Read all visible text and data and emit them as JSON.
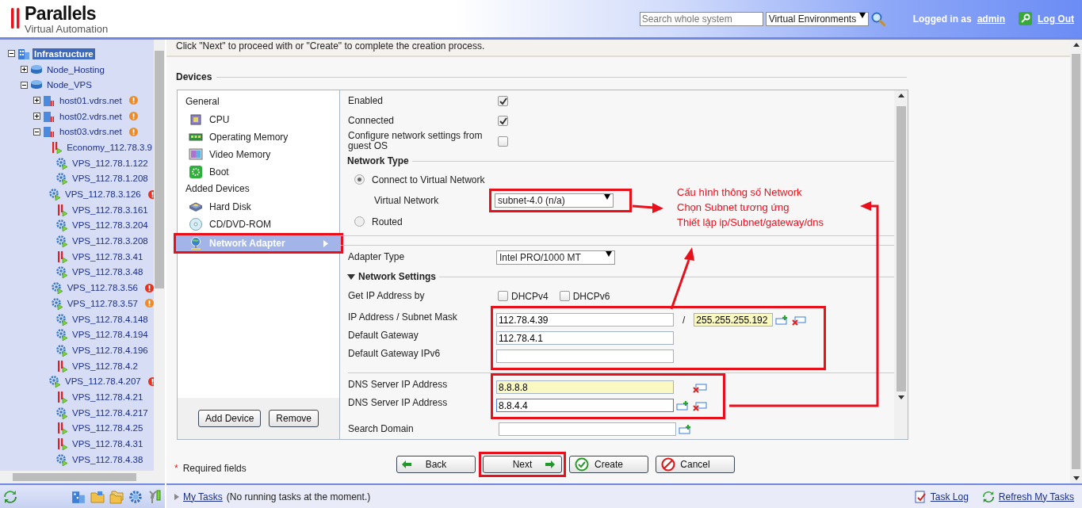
{
  "header": {
    "brand": "Parallels",
    "product": "Virtual Automation",
    "search": {
      "placeholder": "Search whole system"
    },
    "scope": {
      "value": "Virtual Environments"
    },
    "logged_in_label": "Logged in as",
    "user": "admin",
    "logout": "Log Out"
  },
  "tree": [
    {
      "label": "Infrastructure",
      "kind": "datacenter",
      "selected": true,
      "expanded": true,
      "children": [
        {
          "label": "Node_Hosting",
          "kind": "group",
          "selected": false,
          "expanded": false
        },
        {
          "label": "Node_VPS",
          "kind": "group",
          "selected": false,
          "expanded": true,
          "children": [
            {
              "label": "host01.vdrs.net",
              "kind": "host",
              "selected": false,
              "expanded": false,
              "color": "#f08a24"
            },
            {
              "label": "host02.vdrs.net",
              "kind": "host",
              "selected": false,
              "expanded": false,
              "color": "#f08a24"
            },
            {
              "label": "host03.vdrs.net",
              "kind": "host",
              "selected": false,
              "expanded": true,
              "color": "#f08a24",
              "children": [
                {
                  "label": "Economy_112.78.3.9",
                  "kind": "vm",
                  "selected": false
                },
                {
                  "label": "VPS_112.78.1.122",
                  "kind": "container",
                  "selected": false
                },
                {
                  "label": "VPS_112.78.1.208",
                  "kind": "container",
                  "selected": false
                },
                {
                  "label": "VPS_112.78.3.126",
                  "kind": "container",
                  "selected": false,
                  "color": "#e8301e"
                },
                {
                  "label": "VPS_112.78.3.161",
                  "kind": "vm",
                  "selected": false
                },
                {
                  "label": "VPS_112.78.3.204",
                  "kind": "container",
                  "selected": false
                },
                {
                  "label": "VPS_112.78.3.208",
                  "kind": "container",
                  "selected": false
                },
                {
                  "label": "VPS_112.78.3.41",
                  "kind": "vm",
                  "selected": false
                },
                {
                  "label": "VPS_112.78.3.48",
                  "kind": "container",
                  "selected": false
                },
                {
                  "label": "VPS_112.78.3.56",
                  "kind": "container",
                  "selected": false,
                  "color": "#e8301e"
                },
                {
                  "label": "VPS_112.78.3.57",
                  "kind": "container",
                  "selected": false,
                  "color": "#f08a24"
                },
                {
                  "label": "VPS_112.78.4.148",
                  "kind": "container",
                  "selected": false
                },
                {
                  "label": "VPS_112.78.4.194",
                  "kind": "container",
                  "selected": false
                },
                {
                  "label": "VPS_112.78.4.196",
                  "kind": "container",
                  "selected": false
                },
                {
                  "label": "VPS_112.78.4.2",
                  "kind": "vm",
                  "selected": false
                },
                {
                  "label": "VPS_112.78.4.207",
                  "kind": "container",
                  "selected": false,
                  "color": "#e8301e"
                },
                {
                  "label": "VPS_112.78.4.21",
                  "kind": "vm",
                  "selected": false
                },
                {
                  "label": "VPS_112.78.4.217",
                  "kind": "container",
                  "selected": false
                },
                {
                  "label": "VPS_112.78.4.25",
                  "kind": "vm",
                  "selected": false
                },
                {
                  "label": "VPS_112.78.4.31",
                  "kind": "vm",
                  "selected": false
                },
                {
                  "label": "VPS_112.78.4.38",
                  "kind": "container",
                  "selected": false
                }
              ]
            }
          ]
        }
      ]
    }
  ],
  "sidebar_tools": [
    {
      "kind": "refresh"
    },
    {
      "kind": "datacenter"
    },
    {
      "kind": "folder"
    },
    {
      "kind": "folders"
    },
    {
      "kind": "settings"
    },
    {
      "kind": "tools"
    }
  ],
  "intro": "Click \"Next\" to proceed with or \"Create\" to complete the creation process.",
  "devices": {
    "title": "Devices",
    "groups": [
      {
        "title": "General",
        "items": [
          {
            "label": "CPU",
            "kind": "cpu",
            "selected": false,
            "highlighted": false
          },
          {
            "label": "Operating Memory",
            "kind": "memory",
            "selected": false,
            "highlighted": false
          },
          {
            "label": "Video Memory",
            "kind": "video",
            "selected": false,
            "highlighted": false
          },
          {
            "label": "Boot",
            "kind": "boot",
            "selected": false,
            "highlighted": false
          }
        ]
      },
      {
        "title": "Added Devices",
        "items": [
          {
            "label": "Hard Disk",
            "kind": "disk",
            "selected": false,
            "highlighted": false
          },
          {
            "label": "CD/DVD-ROM",
            "kind": "cd",
            "selected": false,
            "highlighted": false
          },
          {
            "label": "Network Adapter",
            "kind": "network",
            "selected": true,
            "highlighted": true
          }
        ]
      }
    ],
    "buttons": [
      "Add Device",
      "Remove"
    ]
  },
  "form": {
    "toggles": [
      {
        "label": "Enabled",
        "checked": true
      },
      {
        "label": "Connected",
        "checked": true
      },
      {
        "label": "Configure network settings from guest OS",
        "checked": false
      }
    ],
    "network_type": {
      "title": "Network Type",
      "options": [
        {
          "label": "Connect to Virtual Network",
          "selected": true
        },
        {
          "label": "Routed",
          "selected": false
        }
      ],
      "virtual_network": {
        "label": "Virtual Network",
        "value": "subnet-4.0 (n/a)",
        "highlighted": true
      }
    },
    "adapter_type": {
      "label": "Adapter Type",
      "value": "Intel PRO/1000 MT"
    },
    "network_settings": {
      "title": "Network Settings",
      "expanded": true,
      "get_ip": {
        "label": "Get IP Address by",
        "options": [
          {
            "label": "DHCPv4",
            "checked": false
          },
          {
            "label": "DHCPv6",
            "checked": false
          }
        ]
      },
      "address_group": {
        "highlighted": true,
        "ip": {
          "label": "IP Address / Subnet Mask",
          "value": "112.78.4.39",
          "separator": "/",
          "mask": "255.255.255.192",
          "mask_flagged": true
        },
        "gateway": {
          "label": "Default Gateway",
          "value": "112.78.4.1"
        },
        "gateway6": {
          "label": "Default Gateway IPv6"
        }
      },
      "dns": {
        "highlighted": true,
        "rows": [
          {
            "label": "DNS Server IP Address",
            "value": "8.8.8.8",
            "flagged": true,
            "focused": false,
            "can_add": false,
            "can_remove": true
          },
          {
            "label": "DNS Server IP Address",
            "value": "8.8.4.4",
            "flagged": false,
            "focused": true,
            "can_add": true,
            "can_remove": true
          }
        ]
      },
      "search_domain": {
        "label": "Search Domain",
        "can_add": true
      }
    }
  },
  "annotation": {
    "lines": [
      "Cấu hình thông số Network",
      "Chọn Subnet tương ứng",
      "Thiết lập ip/Subnet/gateway/dns"
    ]
  },
  "footer": {
    "required_mark": "*",
    "required_text": "Required fields",
    "buttons": [
      {
        "label": "Back",
        "kind": "back",
        "highlighted": false
      },
      {
        "label": "Next",
        "kind": "next",
        "highlighted": true
      },
      {
        "label": "Create",
        "kind": "create",
        "highlighted": false
      },
      {
        "label": "Cancel",
        "kind": "cancel",
        "highlighted": false
      }
    ]
  },
  "status_bar": {
    "tasks_link": "My Tasks",
    "tasks_text": "(No running tasks at the moment.)",
    "task_log": "Task Log",
    "refresh": "Refresh My Tasks"
  }
}
